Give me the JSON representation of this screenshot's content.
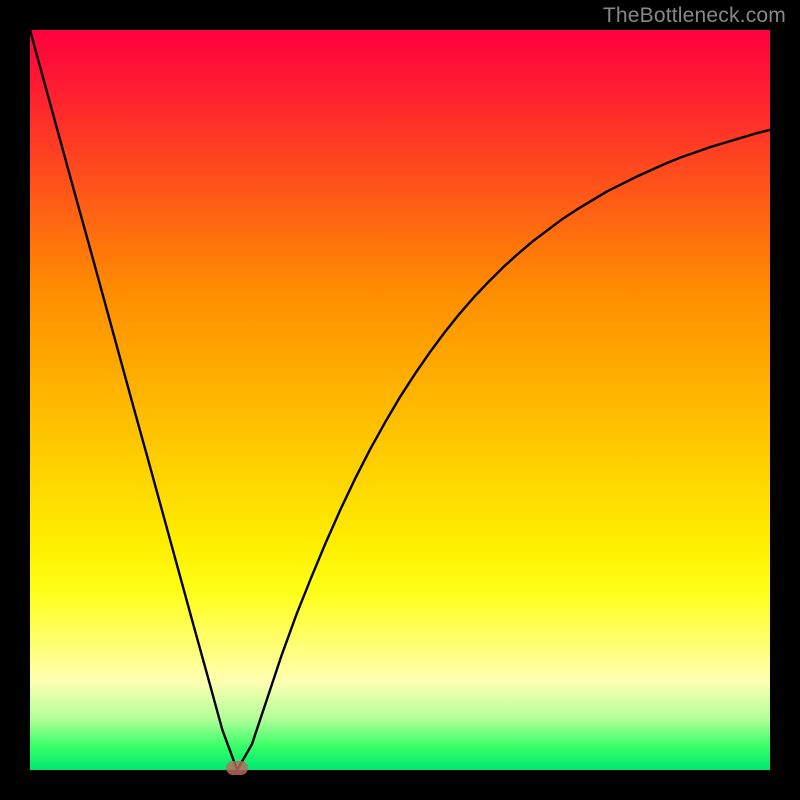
{
  "watermark": "TheBottleneck.com",
  "colors": {
    "frame": "#000000",
    "curve_stroke": "#000000",
    "marker_fill": "#bb6a5f",
    "gradient_top": "#ff0040",
    "gradient_bottom": "#00e673"
  },
  "chart_data": {
    "type": "line",
    "title": "",
    "xlabel": "",
    "ylabel": "",
    "xlim": [
      0,
      100
    ],
    "ylim": [
      0,
      100
    ],
    "x": [
      0,
      2,
      4,
      6,
      8,
      10,
      12,
      14,
      16,
      18,
      20,
      22,
      24,
      26,
      28,
      30,
      32,
      34,
      36,
      38,
      40,
      42,
      44,
      46,
      48,
      50,
      52,
      54,
      56,
      58,
      60,
      62,
      64,
      66,
      68,
      70,
      72,
      74,
      76,
      78,
      80,
      82,
      84,
      86,
      88,
      90,
      92,
      94,
      96,
      98,
      100
    ],
    "values": [
      100,
      92.7,
      85.4,
      78.1,
      70.9,
      63.6,
      56.3,
      49,
      41.8,
      34.5,
      27.2,
      19.9,
      12.7,
      5.4,
      0,
      3.5,
      9.5,
      15.5,
      21,
      26,
      30.8,
      35.3,
      39.5,
      43.4,
      47,
      50.4,
      53.5,
      56.4,
      59.1,
      61.6,
      63.9,
      66,
      68,
      69.8,
      71.5,
      73,
      74.5,
      75.8,
      77,
      78.2,
      79.2,
      80.2,
      81.1,
      82,
      82.8,
      83.5,
      84.2,
      84.8,
      85.4,
      86,
      86.5
    ],
    "bottleneck_point": {
      "x": 28,
      "y": 0
    },
    "grid": false,
    "legend": false
  }
}
